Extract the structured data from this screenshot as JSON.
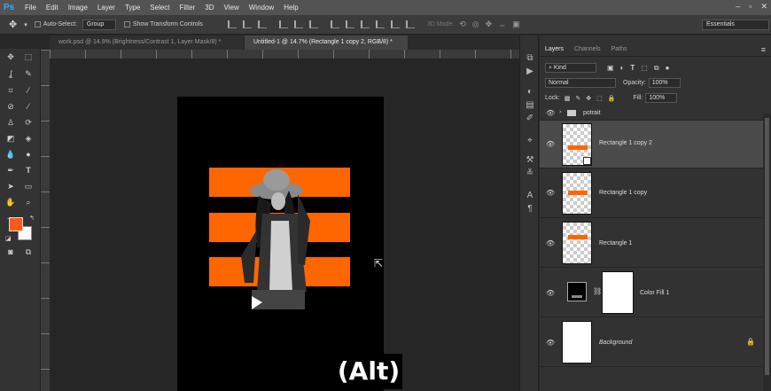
{
  "menu": {
    "logo": "Ps",
    "items": [
      "File",
      "Edit",
      "Image",
      "Layer",
      "Type",
      "Select",
      "Filter",
      "3D",
      "View",
      "Window",
      "Help"
    ]
  },
  "options_bar": {
    "auto_select_label": "Auto-Select:",
    "auto_select_value": "Group",
    "show_transform_label": "Show Transform Controls",
    "mode_3d_label": "3D Mode:",
    "workspace": "Essentials"
  },
  "tabs": [
    {
      "label": "work.psd @ 14.9% (Brightness/Contrast 1, Layer Mask/8) *",
      "active": false
    },
    {
      "label": "Untitled-1 @ 14.7% (Rectangle 1 copy 2, RGB/8) *",
      "active": true
    }
  ],
  "colors": {
    "accent_orange": "#ff6600",
    "foreground": "#ff5a1a",
    "background": "#ffffff"
  },
  "caption": "(Alt)",
  "layers_panel": {
    "tabs": [
      "Layers",
      "Channels",
      "Paths"
    ],
    "filter_kind": "Kind",
    "blend_mode": "Normal",
    "opacity_label": "Opacity:",
    "opacity_value": "100%",
    "lock_label": "Lock:",
    "fill_label": "Fill:",
    "fill_value": "100%",
    "layers": [
      {
        "name": "potrait",
        "type": "group"
      },
      {
        "name": "Rectangle 1 copy 2",
        "type": "shape",
        "selected": true
      },
      {
        "name": "Rectangle 1 copy",
        "type": "shape"
      },
      {
        "name": "Rectangle 1",
        "type": "shape"
      },
      {
        "name": "Color Fill 1",
        "type": "fill"
      },
      {
        "name": "Background",
        "type": "background",
        "locked": true
      }
    ]
  }
}
